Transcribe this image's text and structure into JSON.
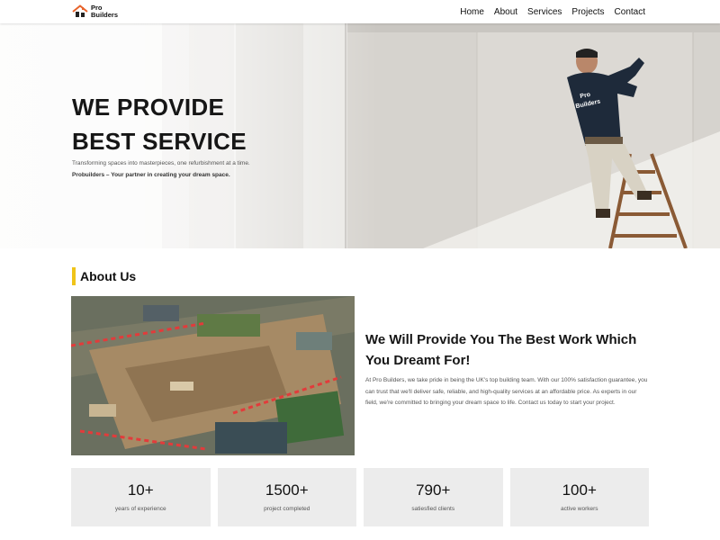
{
  "brand": {
    "line1": "Pro",
    "line2": "Builders",
    "shirt_line1": "Pro",
    "shirt_line2": "Builders"
  },
  "nav": {
    "items": [
      {
        "label": "Home"
      },
      {
        "label": "About"
      },
      {
        "label": "Services"
      },
      {
        "label": "Projects"
      },
      {
        "label": "Contact"
      }
    ]
  },
  "hero": {
    "title_line1": "WE PROVIDE",
    "title_line2": "BEST SERVICE",
    "subtitle": "Transforming spaces into masterpieces, one refurbishment at a time.",
    "subtitle2": "Probuilders – Your partner in creating your dream space."
  },
  "about": {
    "heading": "About Us",
    "tagline_line1": "We Will Provide You The Best Work Which",
    "tagline_line2": "You Dreamt For!",
    "text": "At Pro Builders, we take pride in being the UK's top building team. With our 100% satisfaction guarantee, you can trust that we'll deliver safe, reliable, and high-quality services at an affordable price. As experts in our field, we're committed to bringing your dream space to life. Contact us today to start your project."
  },
  "stats": [
    {
      "value": "10+",
      "label": "years of experience"
    },
    {
      "value": "1500+",
      "label": "project completed"
    },
    {
      "value": "790+",
      "label": "satiesfied clients"
    },
    {
      "value": "100+",
      "label": "active workers"
    }
  ],
  "colors": {
    "accent": "#f0c419",
    "logo_orange": "#e8632b",
    "stat_bg": "#ececec"
  },
  "icons": {
    "logo": "house-roof-icon"
  }
}
